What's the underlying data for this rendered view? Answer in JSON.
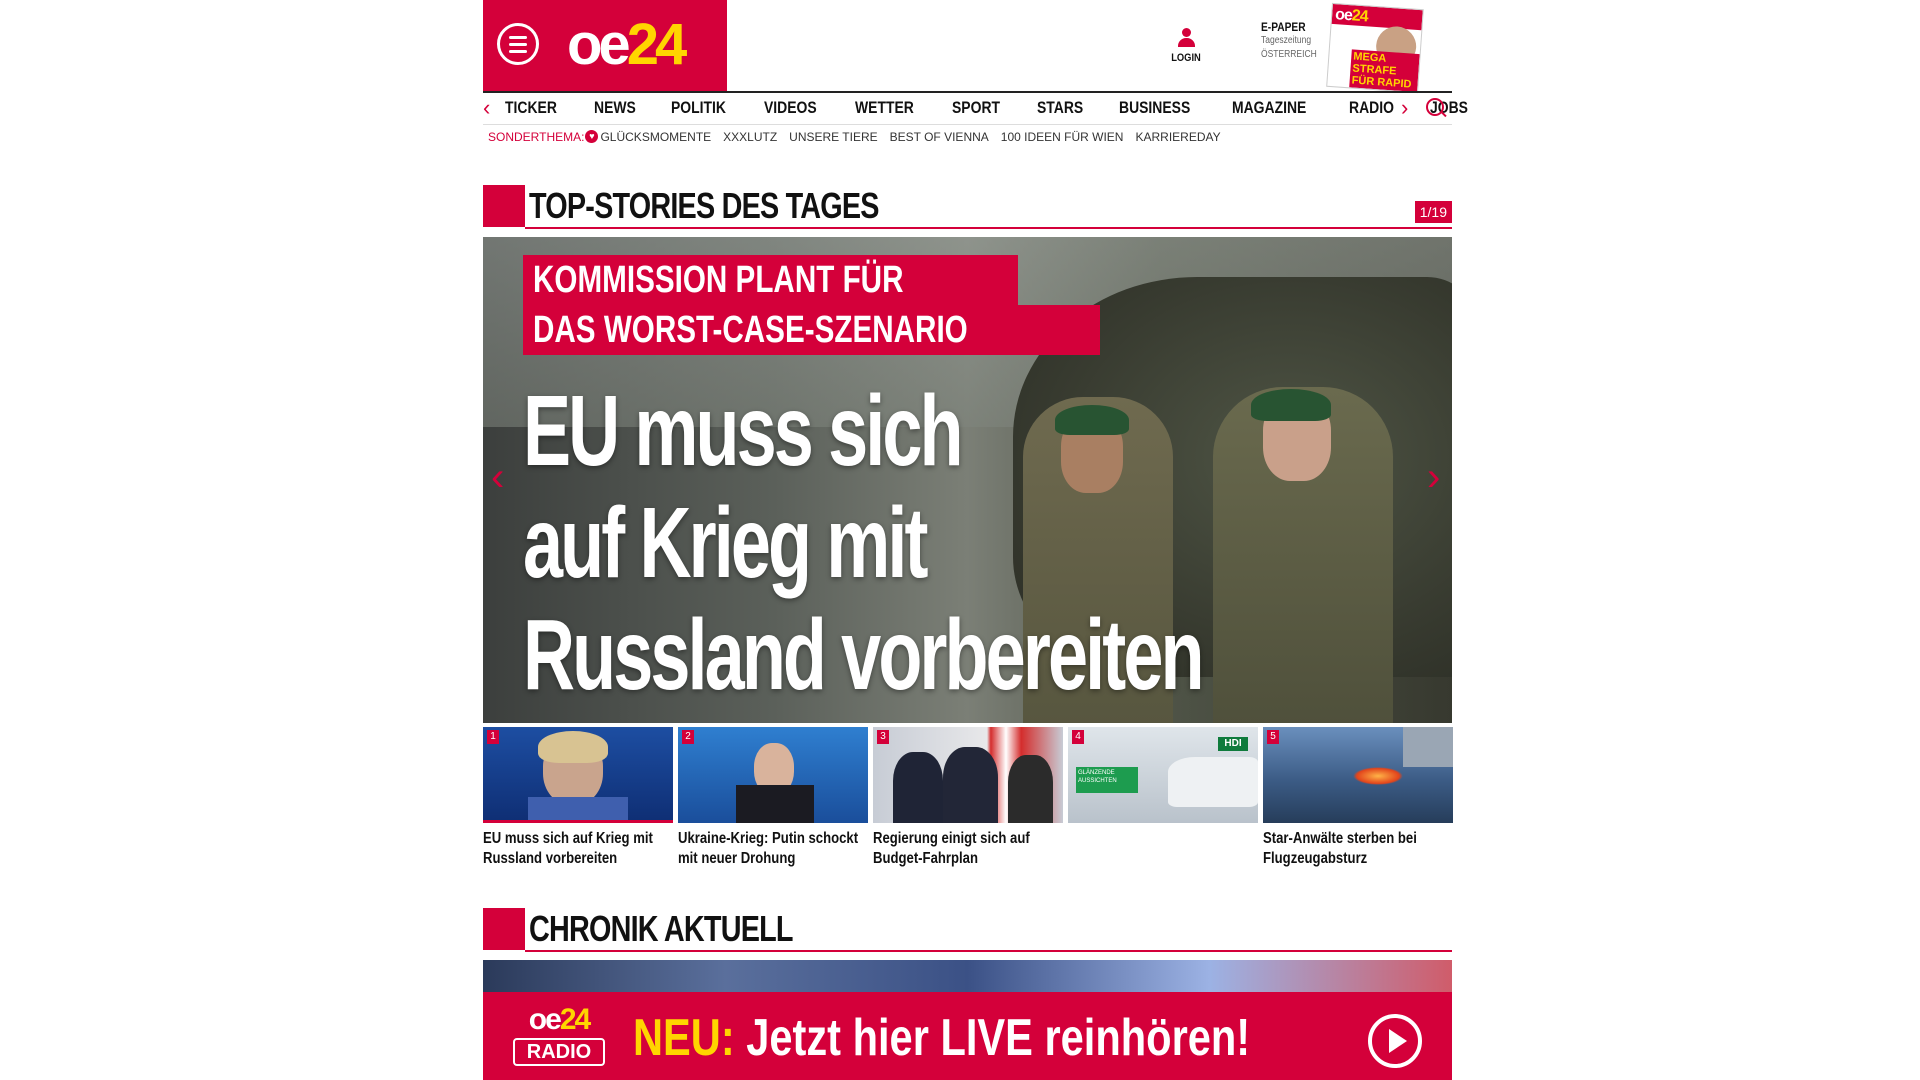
{
  "header": {
    "logo_main": "oe",
    "logo_accent": "24",
    "login_label": "LOGIN",
    "epaper": {
      "title": "E-PAPER",
      "line1": "Tageszeitung",
      "line2": "ÖSTERREICH"
    },
    "paper_cover": {
      "logo_main": "oe",
      "logo_accent": "24",
      "headline": "MEGA STRAFE FÜR RAPID"
    }
  },
  "nav": {
    "items": [
      "TICKER",
      "NEWS",
      "POLITIK",
      "VIDEOS",
      "WETTER",
      "SPORT",
      "STARS",
      "BUSINESS",
      "MAGAZINE",
      "RADIO",
      "JOBS"
    ]
  },
  "subnav": {
    "highlight": "SONDERTHEMA:",
    "items": [
      "GLÜCKSMOMENTE",
      "XXXLUTZ",
      "UNSERE TIERE",
      "BEST OF VIENNA",
      "100 IDEEN FÜR WIEN",
      "KARRIEREDAY"
    ]
  },
  "top_stories": {
    "title": "TOP-STORIES DES TAGES",
    "counter": "1/19",
    "hero": {
      "kicker_line1": "KOMMISSION PLANT FÜR",
      "kicker_line2": "DAS WORST-CASE-SZENARIO",
      "headline_line1": "EU muss sich",
      "headline_line2": "auf Krieg mit",
      "headline_line3": "Russland vorbereiten"
    },
    "thumbs": [
      {
        "num": "1",
        "caption": "EU muss sich auf Krieg mit Russland vorbereiten"
      },
      {
        "num": "2",
        "caption": "Ukraine-Krieg: Putin schockt mit neuer Drohung"
      },
      {
        "num": "3",
        "caption": "Regierung einigt sich auf Budget-Fahrplan"
      },
      {
        "num": "4",
        "caption": "",
        "ad_badge": "HDI",
        "ad_text": "GLÄNZENDE AUSSICHTEN"
      },
      {
        "num": "5",
        "caption": "Star-Anwälte sterben bei Flugzeugabsturz"
      }
    ]
  },
  "chronik": {
    "title": "CHRONIK AKTUELL"
  },
  "radio_banner": {
    "logo_main": "oe",
    "logo_accent": "24",
    "logo_sub": "RADIO",
    "neu": "NEU:",
    "text": "Jetzt hier LIVE reinhören!"
  },
  "colors": {
    "brand_red": "#d4003a",
    "brand_yellow": "#ffd500"
  },
  "icons": [
    "menu-icon",
    "user-icon",
    "chevron-left-icon",
    "chevron-right-icon",
    "search-icon",
    "play-icon"
  ]
}
